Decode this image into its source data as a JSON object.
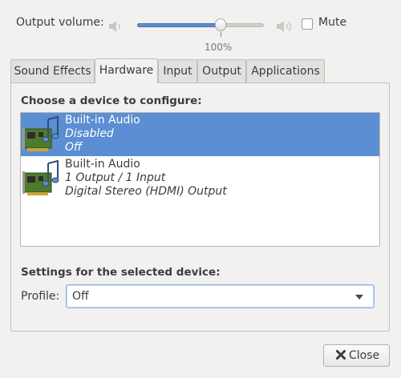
{
  "volume": {
    "label": "Output volume:",
    "level_percent": 65,
    "tick_label": "100%",
    "mute_label": "Mute",
    "mute_checked": false
  },
  "tabs": [
    {
      "label": "Sound Effects",
      "active": false
    },
    {
      "label": "Hardware",
      "active": true
    },
    {
      "label": "Input",
      "active": false
    },
    {
      "label": "Output",
      "active": false
    },
    {
      "label": "Applications",
      "active": false
    }
  ],
  "hardware": {
    "choose_label": "Choose a device to configure:",
    "devices": [
      {
        "name": "Built-in Audio",
        "line2": "Disabled",
        "line3": "Off",
        "selected": true,
        "icon": "sound-card-icon"
      },
      {
        "name": "Built-in Audio",
        "line2": "1 Output / 1 Input",
        "line3": "Digital Stereo (HDMI) Output",
        "selected": false,
        "icon": "sound-card-icon"
      }
    ],
    "settings_label": "Settings for the selected device:",
    "profile_label": "Profile:",
    "profile_value": "Off"
  },
  "footer": {
    "close_label": "Close"
  },
  "colors": {
    "accent": "#5b8ed2",
    "window_bg": "#f2f1f0"
  }
}
